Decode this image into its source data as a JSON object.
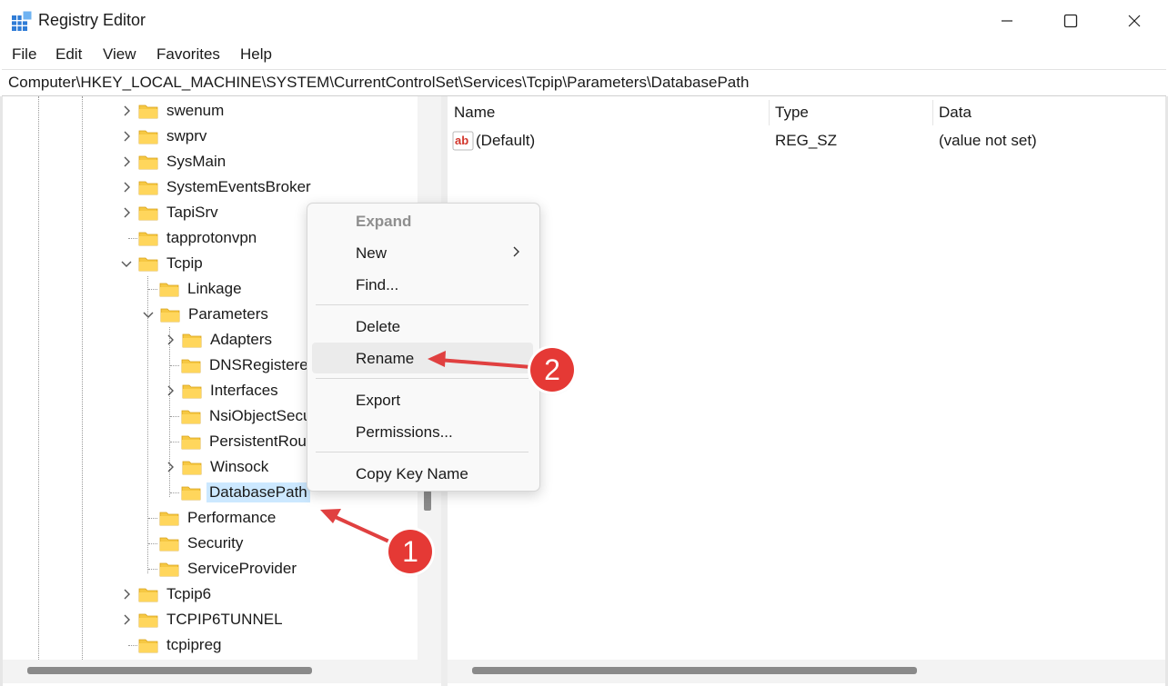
{
  "window": {
    "title": "Registry Editor"
  },
  "menu": {
    "items": [
      "File",
      "Edit",
      "View",
      "Favorites",
      "Help"
    ]
  },
  "address": {
    "path": "Computer\\HKEY_LOCAL_MACHINE\\SYSTEM\\CurrentControlSet\\Services\\Tcpip\\Parameters\\DatabasePath"
  },
  "tree": {
    "swenum": "swenum",
    "swprv": "swprv",
    "sysmain": "SysMain",
    "systemeventsbroker": "SystemEventsBroker",
    "tapisrv": "TapiSrv",
    "tapprotonvpn": "tapprotonvpn",
    "tcpip": "Tcpip",
    "linkage": "Linkage",
    "parameters": "Parameters",
    "adapters": "Adapters",
    "dnsregistered": "DNSRegistere",
    "interfaces": "Interfaces",
    "nsiobjectsecurity": "NsiObjectSecu",
    "persistentroutes": "PersistentRou",
    "winsock": "Winsock",
    "databasepath": "DatabasePath",
    "performance": "Performance",
    "security": "Security",
    "serviceprovider": "ServiceProvider",
    "tcpip6": "Tcpip6",
    "tcpip6tunnel": "TCPIP6TUNNEL",
    "tcpipreg": "tcpipreg"
  },
  "list": {
    "columns": {
      "name": "Name",
      "type": "Type",
      "data": "Data"
    },
    "rows": [
      {
        "name": "(Default)",
        "type": "REG_SZ",
        "data": "(value not set)",
        "icon": "string-value-icon"
      }
    ]
  },
  "context_menu": {
    "expand": "Expand",
    "new": "New",
    "find": "Find...",
    "delete": "Delete",
    "rename": "Rename",
    "export": "Export",
    "permissions": "Permissions...",
    "copy_key_name": "Copy Key Name"
  },
  "annotations": {
    "step1": "1",
    "step2": "2"
  },
  "colors": {
    "selection": "#cce8ff",
    "folder": "#f6c843",
    "badge": "#e53935",
    "arrow": "#e04040",
    "menu_hover": "#ebebeb"
  }
}
